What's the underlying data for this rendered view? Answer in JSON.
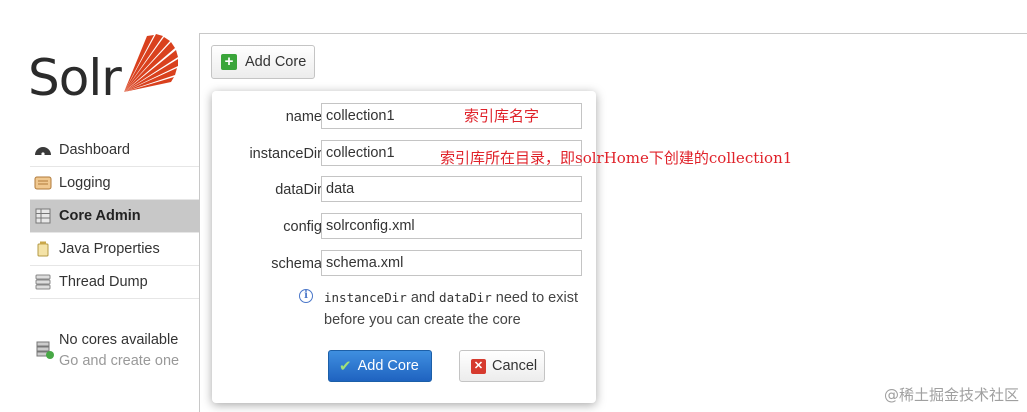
{
  "app": {
    "logo_text": "Solr",
    "brand_color": "#d9411e"
  },
  "sidebar": {
    "items": [
      {
        "label": "Dashboard",
        "icon": "dashboard-icon"
      },
      {
        "label": "Logging",
        "icon": "logging-icon"
      },
      {
        "label": "Core Admin",
        "icon": "core-admin-icon",
        "active": true
      },
      {
        "label": "Java Properties",
        "icon": "java-properties-icon"
      },
      {
        "label": "Thread Dump",
        "icon": "thread-dump-icon"
      }
    ],
    "no_cores": {
      "title": "No cores available",
      "subtitle": "Go and create one"
    }
  },
  "toolbar": {
    "add_core_label": "Add Core"
  },
  "dialog": {
    "fields": [
      {
        "label": "name:",
        "value": "collection1"
      },
      {
        "label": "instanceDir:",
        "value": "collection1"
      },
      {
        "label": "dataDir:",
        "value": "data"
      },
      {
        "label": "config:",
        "value": "solrconfig.xml"
      },
      {
        "label": "schema:",
        "value": "schema.xml"
      }
    ],
    "hint": {
      "code1": "instanceDir",
      "and": " and ",
      "code2": "dataDir",
      "text1": " need to exist",
      "text2": "before you can create the core"
    },
    "submit_label": "Add Core",
    "cancel_label": "Cancel"
  },
  "annotations": {
    "name_note": "索引库名字",
    "dir_note": "索引库所在目录，即solrHome下创建的collection1",
    "color": "#e0222a"
  },
  "watermark": "@稀土掘金技术社区"
}
